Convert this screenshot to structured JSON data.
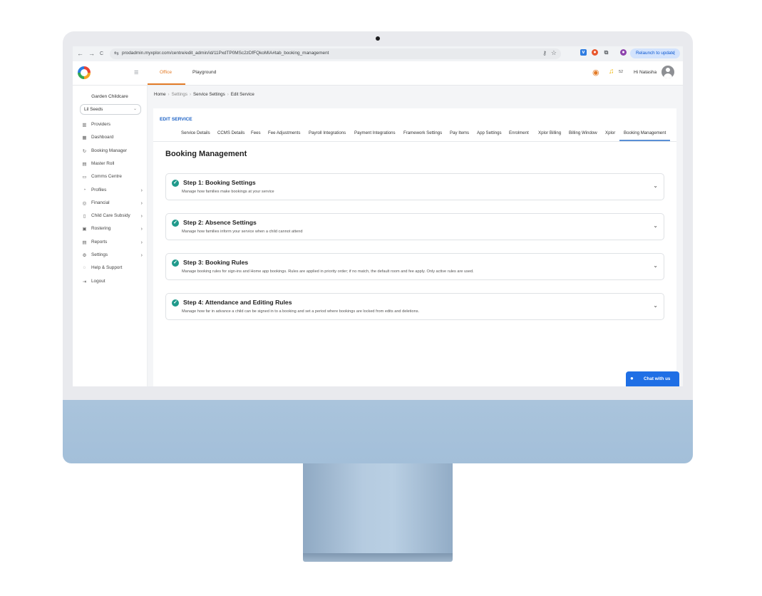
{
  "browser": {
    "url": "prodadmin.myxplor.com/centre/edit_admin/id/11PxdTP0MSc2zDfFQkoMIA#tab_booking_management",
    "relaunch_label": "Relaunch to update",
    "back_icon": "←",
    "forward_icon": "→",
    "reload_icon": "C",
    "menu_icon": "⋮"
  },
  "header": {
    "nav": [
      {
        "label": "Office",
        "active": true
      },
      {
        "label": "Playground",
        "active": false
      }
    ],
    "notification_count": "52",
    "greeting": "Hi Natasha"
  },
  "sidebar": {
    "org_name": "Garden Childcare",
    "service_selected": "Lil Seeds",
    "items": [
      {
        "label": "Providers",
        "icon": "building-icon",
        "glyph": "▥",
        "has_children": false
      },
      {
        "label": "Dashboard",
        "icon": "dashboard-icon",
        "glyph": "▦",
        "has_children": false
      },
      {
        "label": "Booking Manager",
        "icon": "refresh-icon",
        "glyph": "↻",
        "has_children": false
      },
      {
        "label": "Master Roll",
        "icon": "calendar-icon",
        "glyph": "▤",
        "has_children": false
      },
      {
        "label": "Comms Centre",
        "icon": "message-icon",
        "glyph": "▭",
        "has_children": false
      },
      {
        "label": "Profiles",
        "icon": "user-icon",
        "glyph": "◔",
        "has_children": true
      },
      {
        "label": "Financial",
        "icon": "dollar-icon",
        "glyph": "◎",
        "has_children": true
      },
      {
        "label": "Child Care Subsidy",
        "icon": "bank-icon",
        "glyph": "▯",
        "has_children": true
      },
      {
        "label": "Rostering",
        "icon": "roster-icon",
        "glyph": "▣",
        "has_children": true
      },
      {
        "label": "Reports",
        "icon": "report-icon",
        "glyph": "▤",
        "has_children": true
      },
      {
        "label": "Settings",
        "icon": "gear-icon",
        "glyph": "⚙",
        "has_children": true
      },
      {
        "label": "Help & Support",
        "icon": "help-icon",
        "glyph": "◌",
        "has_children": false
      },
      {
        "label": "Logout",
        "icon": "logout-icon",
        "glyph": "⇥",
        "has_children": false
      }
    ]
  },
  "breadcrumb": {
    "items": [
      "Home",
      "Settings",
      "Service Settings",
      "Edit Service"
    ]
  },
  "panel": {
    "section_label": "EDIT SERVICE",
    "tabs": [
      {
        "label": "Service Details"
      },
      {
        "label": "CCMS Details"
      },
      {
        "label": "Fees"
      },
      {
        "label": "Fee Adjustments"
      },
      {
        "label": "Payroll Integrations"
      },
      {
        "label": "Payment Integrations"
      },
      {
        "label": "Framework Settings"
      },
      {
        "label": "Pay Items"
      },
      {
        "label": "App Settings"
      },
      {
        "label": "Enrolment"
      },
      {
        "label": "Xplor Billing"
      },
      {
        "label": "Billing Window"
      },
      {
        "label": "Xplor"
      },
      {
        "label": "Booking Management",
        "active": true
      }
    ],
    "title": "Booking Management",
    "steps": [
      {
        "title": "Step 1: Booking Settings",
        "desc": "Manage how families make bookings at your service"
      },
      {
        "title": "Step 2: Absence Settings",
        "desc": "Manage how families inform your service when a child cannot attend"
      },
      {
        "title": "Step 3: Booking Rules",
        "desc": "Manage booking rules for sign-ins and Home app bookings. Rules are applied in priority order; if no match, the default room and fee apply. Only active rules are used."
      },
      {
        "title": "Step 4: Attendance and Editing Rules",
        "desc": "Manage how far in advance a child can be signed in to a booking and set a period where bookings are locked from edits and deletions."
      }
    ]
  },
  "chat": {
    "label": "Chat with us"
  },
  "colors": {
    "accent": "#e37b27",
    "link_blue": "#1e63c6",
    "check_green": "#1f9a8b",
    "chat_blue": "#1f6fe5"
  }
}
